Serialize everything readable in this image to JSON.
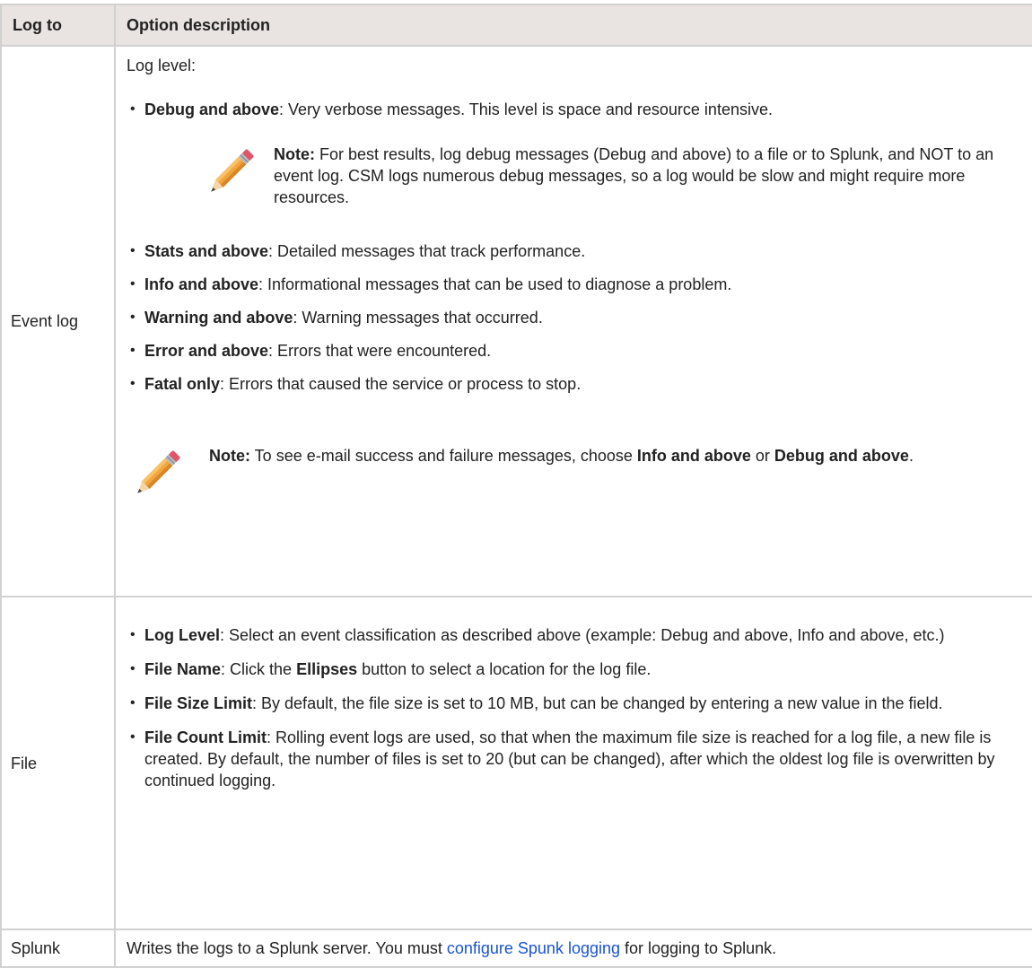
{
  "header": {
    "col1": "Log to",
    "col2": "Option description"
  },
  "event_log": {
    "label": "Event log",
    "intro": "Log level:",
    "items": [
      {
        "term": "Debug and above",
        "desc": ": Very verbose messages. This level is space and resource intensive."
      },
      {
        "term": "Stats and above",
        "desc": ": Detailed messages that track performance."
      },
      {
        "term": "Info and above",
        "desc": ": Informational messages that can be used to diagnose a problem."
      },
      {
        "term": "Warning and above",
        "desc": ": Warning messages that occurred."
      },
      {
        "term": "Error and above",
        "desc": ": Errors that were encountered."
      },
      {
        "term": "Fatal only",
        "desc": ": Errors that caused the service or process to stop."
      }
    ],
    "note1": {
      "label": "Note:",
      "text": " For best results, log debug messages (Debug and above) to a file or to Splunk, and NOT to an event log. CSM logs numerous debug messages, so a log would be slow and might require more resources."
    },
    "note2": {
      "label": "Note:",
      "text_a": " To see e-mail success and failure messages, choose ",
      "bold_a": "Info and above",
      "text_b": " or ",
      "bold_b": "Debug and above",
      "text_c": "."
    },
    "note_icon": "pencil-icon"
  },
  "file": {
    "label": "File",
    "items": [
      {
        "term": "Log Level",
        "desc": ": Select an event classification as described above (example: Debug and above, Info and above, etc.)"
      },
      {
        "term": "File Name",
        "desc_a": ": Click the ",
        "bold": "Ellipses",
        "desc_b": " button to select a location for the log file."
      },
      {
        "term": "File Size Limit",
        "desc": ": By default, the file size is set to 10 MB, but can be changed by entering a new value in the field."
      },
      {
        "term": "File Count Limit",
        "desc": ": Rolling event logs are used, so that when the maximum file size is reached for a log file, a new file is created. By default, the number of files is set to 20 (but can be changed), after which the oldest log file is overwritten by continued logging."
      }
    ]
  },
  "splunk": {
    "label": "Splunk",
    "text_a": "Writes the logs to a Splunk server. You must ",
    "link": "configure Spunk logging",
    "text_b": " for logging to Splunk."
  },
  "colors": {
    "header_bg": "#e9e4e1",
    "border": "#d1d1d1",
    "link": "#1a53d6"
  }
}
